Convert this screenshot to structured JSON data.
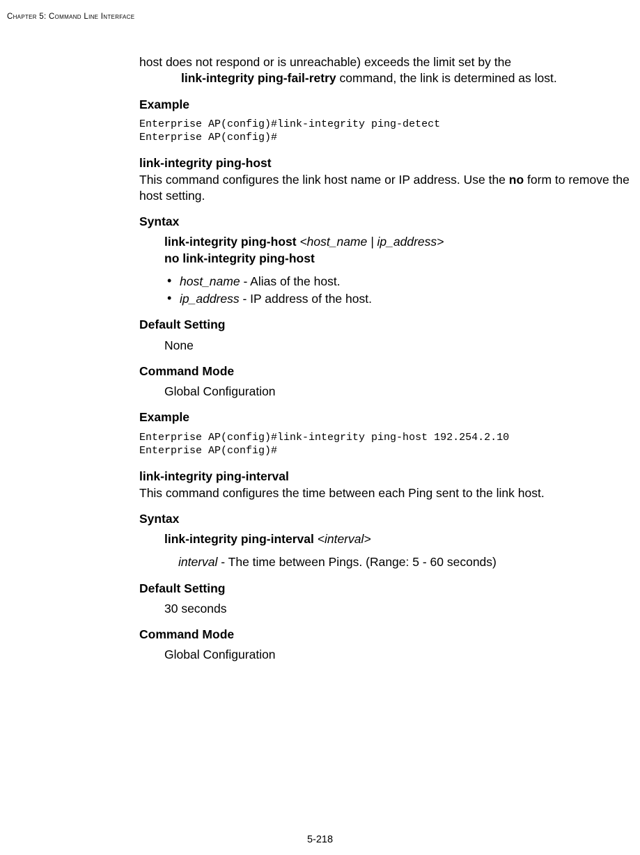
{
  "runningHead": "Chapter 5: Command Line Interface",
  "pageNumber": "5-218",
  "intro": {
    "line1": "host does not respond or is unreachable) exceeds the limit set by the",
    "line2a": "link-integrity ping-fail-retry",
    "line2b": " command, the link is determined as lost."
  },
  "example1": {
    "heading": "Example",
    "code": "Enterprise AP(config)#link-integrity ping-detect\nEnterprise AP(config)#"
  },
  "pingHost": {
    "title": "link-integrity ping-host",
    "desc1": "This command configures the link host name or IP address. Use the ",
    "descBold": "no",
    "desc2": " form to remove the host setting.",
    "syntaxHeading": "Syntax",
    "synBold1": "link-integrity ping-host ",
    "synItal1": "<host_name | ip_address>",
    "synBold2": "no link-integrity ping-host",
    "b1a": "host_name",
    "b1b": " - Alias of the host.",
    "b2a": "ip_address",
    "b2b": " - IP address of the host.",
    "defHeading": "Default Setting",
    "defVal": "None",
    "modeHeading": "Command Mode",
    "modeVal": "Global Configuration",
    "exHeading": "Example",
    "exCode": "Enterprise AP(config)#link-integrity ping-host 192.254.2.10\nEnterprise AP(config)#"
  },
  "pingInterval": {
    "title": "link-integrity ping-interval",
    "desc": "This command configures the time between each Ping sent to the link host.",
    "syntaxHeading": "Syntax",
    "synBold": "link-integrity ping-interval ",
    "synItal": "<interval>",
    "explainItal": "interval",
    "explainRest": " - The time between Pings. (Range: 5 - 60 seconds)",
    "defHeading": "Default Setting",
    "defVal": "30 seconds",
    "modeHeading": "Command Mode",
    "modeVal": "Global Configuration"
  }
}
